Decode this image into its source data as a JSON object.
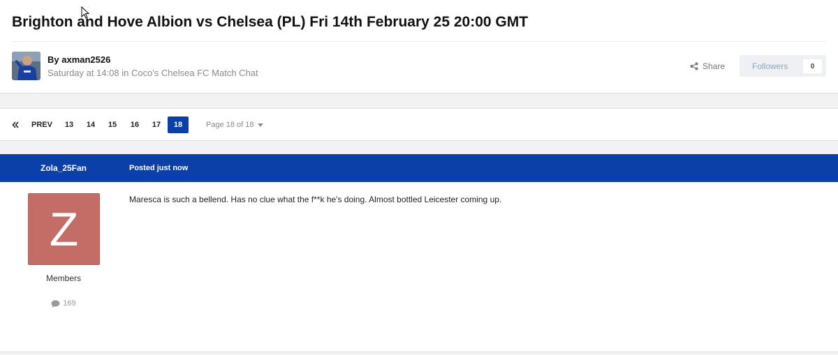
{
  "topic": {
    "title": "Brighton and Hove Albion vs Chelsea (PL) Fri 14th February 25 20:00 GMT",
    "author_line": "By axman2526",
    "meta": "Saturday at 14:08 in Coco's Chelsea FC Match Chat",
    "share_label": "Share",
    "followers_label": "Followers",
    "followers_count": "0"
  },
  "pagination": {
    "prev_label": "PREV",
    "first_icon": "double-chevron-left-icon",
    "pages": [
      "13",
      "14",
      "15",
      "16",
      "17",
      "18"
    ],
    "active_page": "18",
    "page_info": "Page 18 of 18"
  },
  "post": {
    "username": "Zola_25Fan",
    "posted": "Posted just now",
    "avatar_letter": "Z",
    "group": "Members",
    "post_count": "169",
    "body": "Maresca is such a bellend. Has no clue what the f**k he's doing. Almost bottled Leicester coming up."
  },
  "colors": {
    "accent": "#0b40a8",
    "avatar_bg": "#c46c66"
  }
}
